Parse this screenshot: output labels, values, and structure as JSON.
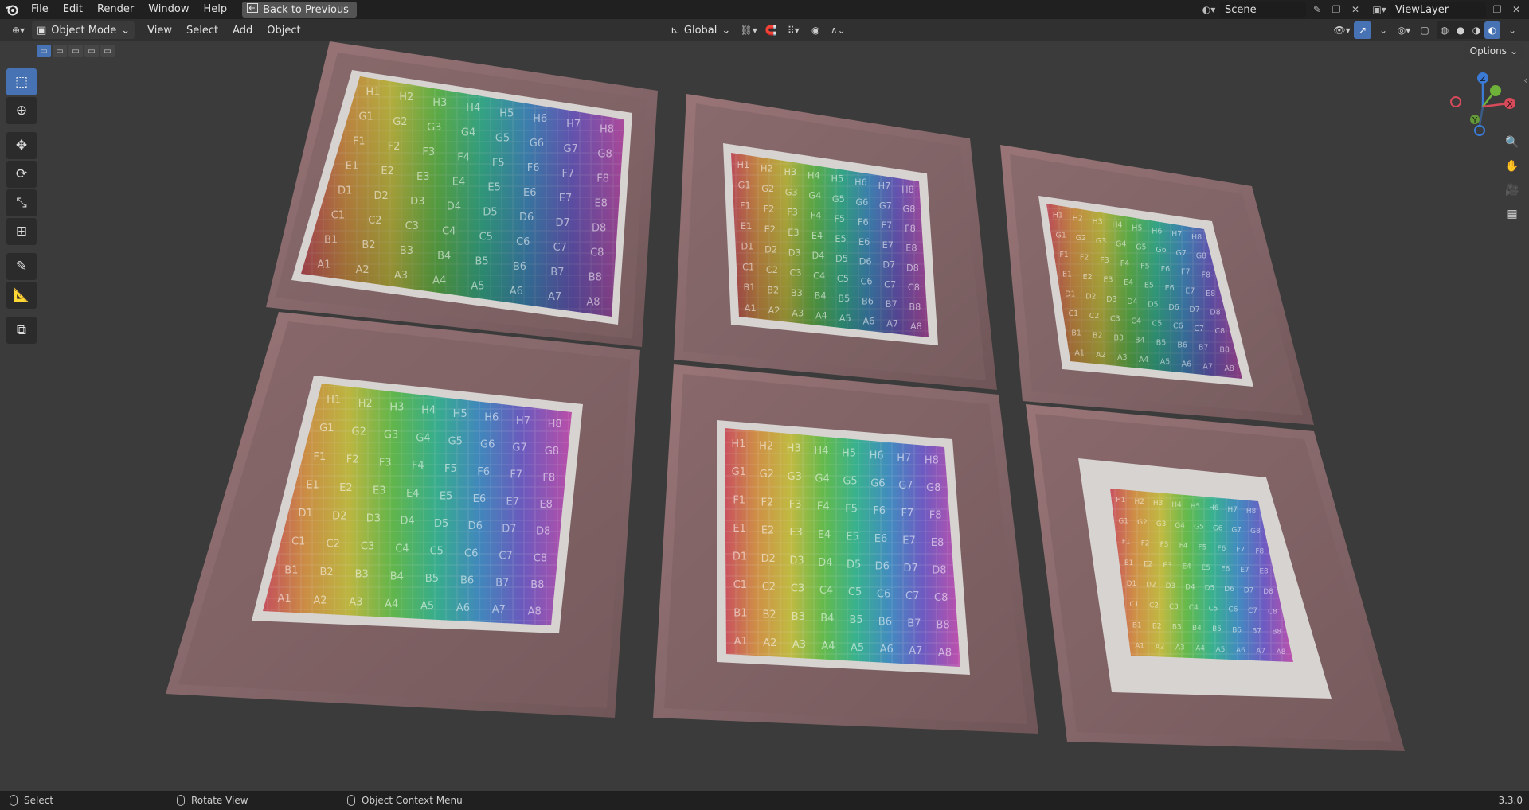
{
  "topbar": {
    "menus": [
      "File",
      "Edit",
      "Render",
      "Window",
      "Help"
    ],
    "back_button": "Back to Previous",
    "scene_name": "Scene",
    "view_layer": "ViewLayer"
  },
  "header": {
    "mode": "Object Mode",
    "menus": [
      "View",
      "Select",
      "Add",
      "Object"
    ],
    "transform_orientation": "Global",
    "options": "Options"
  },
  "gizmo": {
    "z": "Z",
    "y": "Y",
    "x": "X"
  },
  "frames": [
    {
      "rows": [
        [
          "H1",
          "H2",
          "H3",
          "H4",
          "H5",
          "H6",
          "H7",
          "H8"
        ],
        [
          "G1",
          "G2",
          "G3",
          "G4",
          "G5",
          "G6",
          "G7",
          "G8"
        ],
        [
          "F1",
          "F2",
          "F3",
          "F4",
          "F5",
          "F6",
          "F7",
          "F8"
        ],
        [
          "E1",
          "E2",
          "E3",
          "E4",
          "E5",
          "E6",
          "E7",
          "E8"
        ],
        [
          "D1",
          "D2",
          "D3",
          "D4",
          "D5",
          "D6",
          "D7",
          "D8"
        ],
        [
          "C1",
          "C2",
          "C3",
          "C4",
          "C5",
          "C6",
          "C7",
          "C8"
        ],
        [
          "B1",
          "B2",
          "B3",
          "B4",
          "B5",
          "B6",
          "B7",
          "B8"
        ],
        [
          "A1",
          "A2",
          "A3",
          "A4",
          "A5",
          "A6",
          "A7",
          "A8"
        ]
      ]
    }
  ],
  "status": {
    "left": "Select",
    "middle": "Rotate View",
    "right": "Object Context Menu",
    "version": "3.3.0"
  },
  "colors": {
    "accent": "#4772b3",
    "frame_wood": "#8c6a6c",
    "mat": "#d5d2cf"
  }
}
